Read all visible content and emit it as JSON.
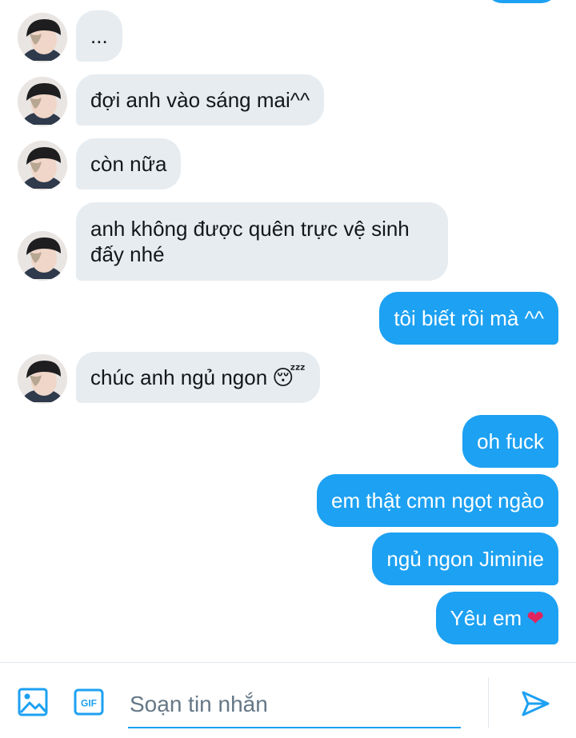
{
  "messages": [
    {
      "direction": "in",
      "text": "..."
    },
    {
      "direction": "in",
      "text": "đợi anh vào sáng mai^^"
    },
    {
      "direction": "in",
      "text": "còn nữa"
    },
    {
      "direction": "in",
      "text": "anh không được quên trực vệ sinh đấy nhé"
    },
    {
      "direction": "out",
      "text": "tôi biết rồi mà ^^"
    },
    {
      "direction": "in",
      "text": "chúc anh ngủ ngon",
      "emoji": "😴"
    },
    {
      "direction": "out",
      "text": "oh fuck"
    },
    {
      "direction": "out",
      "text": "em thật cmn ngọt ngào"
    },
    {
      "direction": "out",
      "text": "ngủ ngon Jiminie"
    },
    {
      "direction": "out",
      "text": "Yêu em",
      "emoji": "❤"
    }
  ],
  "composer": {
    "placeholder": "Soạn tin nhắn",
    "image_icon": "image-icon",
    "gif_icon": "gif-icon",
    "gif_label": "GIF",
    "send_icon": "send-icon"
  },
  "colors": {
    "accent": "#1da1f2",
    "incoming_bubble": "#e7ecf0",
    "text": "#14171a",
    "placeholder": "#657786"
  }
}
